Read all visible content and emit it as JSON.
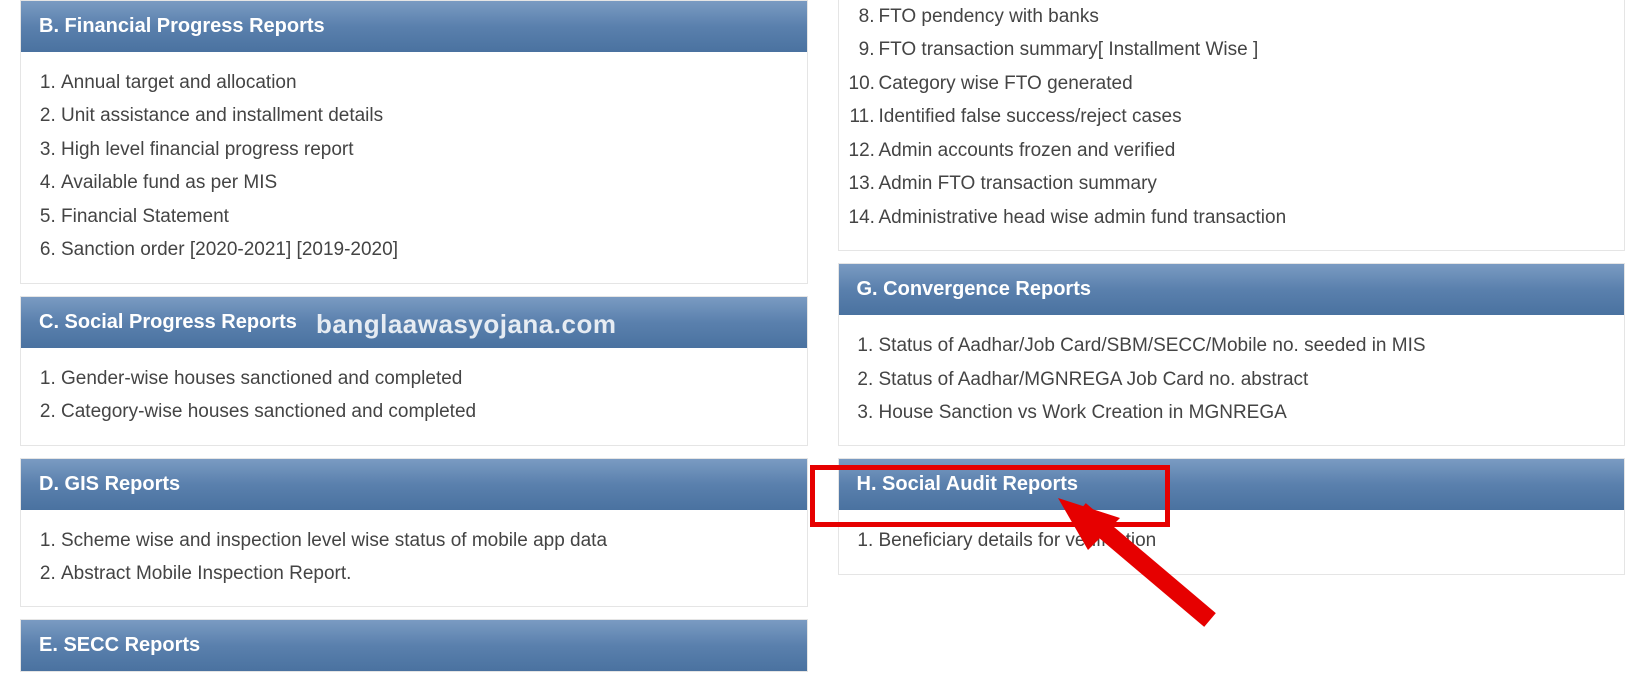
{
  "watermark": "banglaawasyojana.com",
  "left": {
    "sections": [
      {
        "title": "B. Financial Progress Reports",
        "items": [
          "Annual target and allocation",
          "Unit assistance and installment details",
          "High level financial progress report",
          "Available fund as per MIS",
          "Financial Statement",
          "Sanction order [2020-2021] [2019-2020]"
        ]
      },
      {
        "title": "C. Social Progress Reports",
        "items": [
          "Gender-wise houses sanctioned and completed",
          "Category-wise houses sanctioned and completed"
        ]
      },
      {
        "title": "D. GIS Reports",
        "items": [
          "Scheme wise and inspection level wise status of mobile app data",
          "Abstract Mobile Inspection Report."
        ]
      },
      {
        "title": "E. SECC Reports",
        "items": []
      }
    ]
  },
  "right": {
    "continuation": [
      "FTO pendency with banks",
      "FTO transaction summary[ Installment Wise ]",
      "Category wise FTO generated",
      "Identified false success/reject cases",
      "Admin accounts frozen and verified",
      "Admin FTO transaction summary",
      "Administrative head wise admin fund transaction"
    ],
    "sections": [
      {
        "title": "G. Convergence Reports",
        "items": [
          "Status of Aadhar/Job Card/SBM/SECC/Mobile no. seeded in MIS",
          "Status of Aadhar/MGNREGA Job Card no. abstract",
          "House Sanction vs Work Creation in MGNREGA"
        ]
      },
      {
        "title": "H. Social Audit Reports",
        "items": [
          "Beneficiary details for verification"
        ]
      }
    ]
  }
}
